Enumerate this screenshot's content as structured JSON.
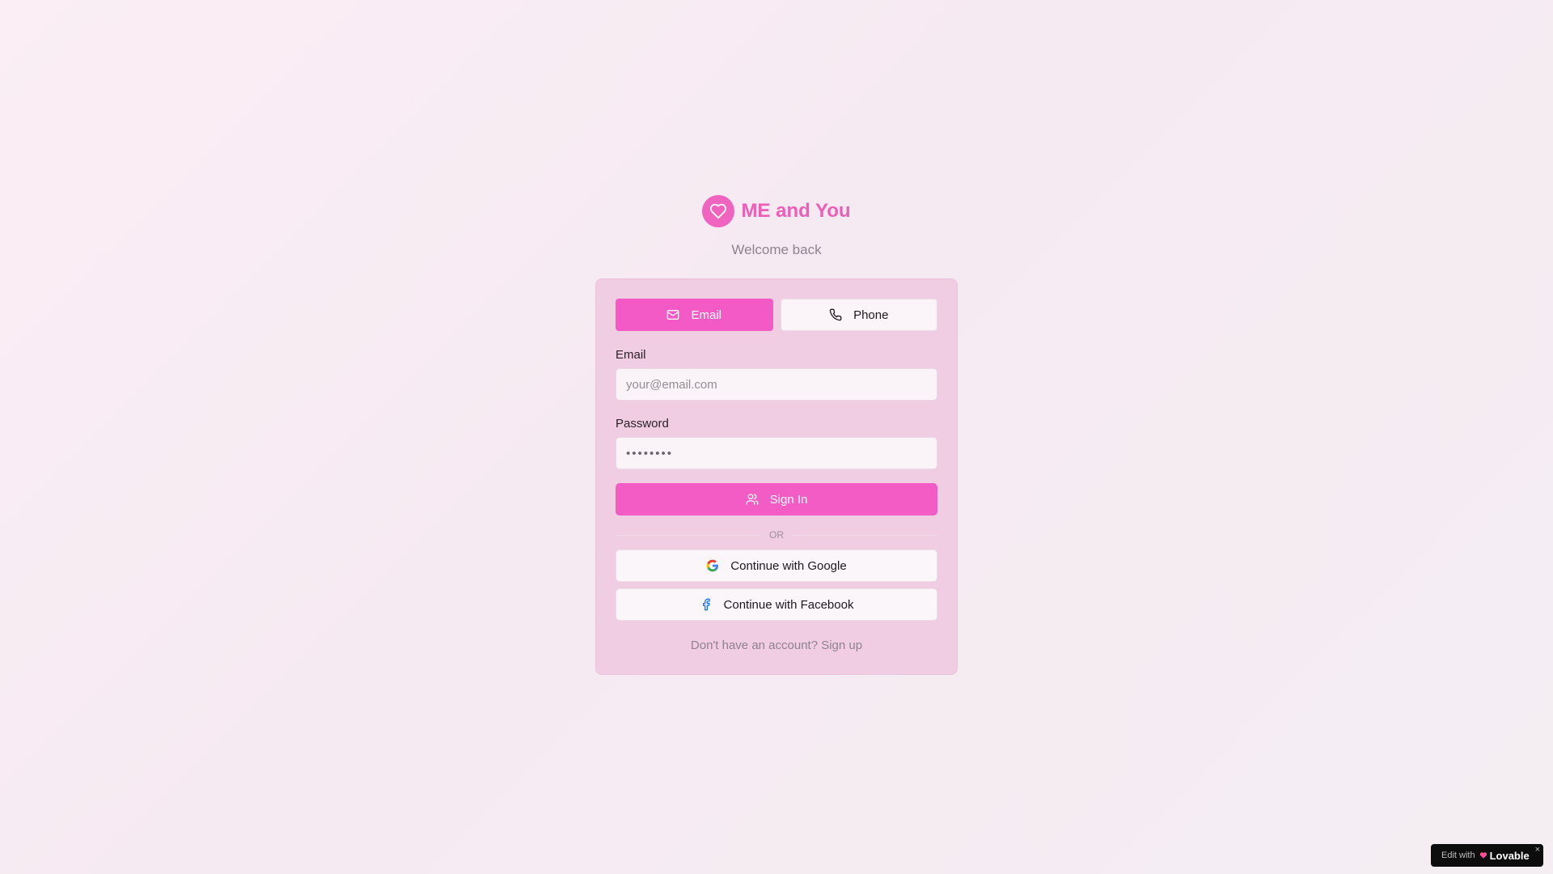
{
  "brand": {
    "title": "ME and You",
    "subtitle": "Welcome back",
    "logo_icon": "heart-icon",
    "color": "#f064bf"
  },
  "tabs": [
    {
      "label": "Email",
      "icon": "mail-icon",
      "active": true
    },
    {
      "label": "Phone",
      "icon": "phone-icon",
      "active": false
    }
  ],
  "form": {
    "email_label": "Email",
    "email_placeholder": "your@email.com",
    "email_value": "",
    "password_label": "Password",
    "password_value": "••••••••",
    "submit_label": "Sign In",
    "submit_icon": "users-icon"
  },
  "divider_text": "OR",
  "social": {
    "google_label": "Continue with Google",
    "google_icon": "google-icon",
    "facebook_label": "Continue with Facebook",
    "facebook_icon": "facebook-icon"
  },
  "footer": {
    "signup_text": "Don't have an account? Sign up"
  },
  "badge": {
    "prefix": "Edit with",
    "brand": "Lovable",
    "close": "×"
  },
  "colors": {
    "accent": "#f35ac6",
    "card": "#f1cde4",
    "google_blue": "#4285F4",
    "google_red": "#EA4335",
    "google_yellow": "#FBBC05",
    "google_green": "#34A853",
    "facebook_blue": "#1877F2"
  }
}
